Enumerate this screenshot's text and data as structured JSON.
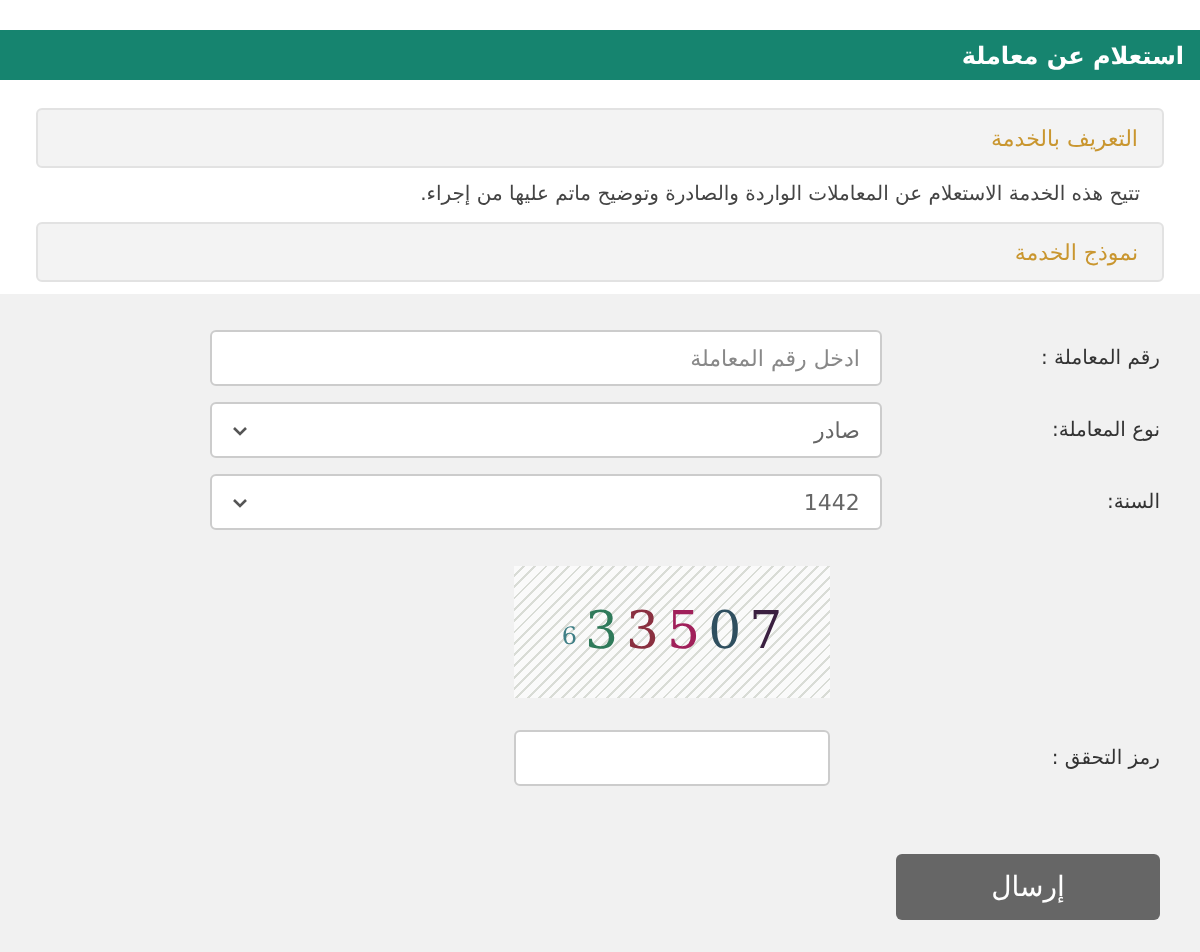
{
  "header": {
    "title": "استعلام عن معاملة"
  },
  "sections": [
    {
      "title": "التعريف بالخدمة",
      "description": "تتيح هذه الخدمة الاستعلام عن المعاملات الواردة والصادرة وتوضيح ماتم عليها من إجراء."
    },
    {
      "title": "نموذج الخدمة"
    }
  ],
  "form": {
    "fields": [
      {
        "kind": "text",
        "label": "رقم المعاملة :",
        "placeholder": "ادخل رقم المعاملة"
      },
      {
        "kind": "select",
        "label": "نوع المعاملة:",
        "value": "صادر"
      },
      {
        "kind": "select",
        "label": "السنة:",
        "value": "1442"
      }
    ],
    "captcha": {
      "text": "633507"
    },
    "captcha_field": {
      "label": "رمز التحقق :"
    },
    "submit": "إرسال"
  }
}
